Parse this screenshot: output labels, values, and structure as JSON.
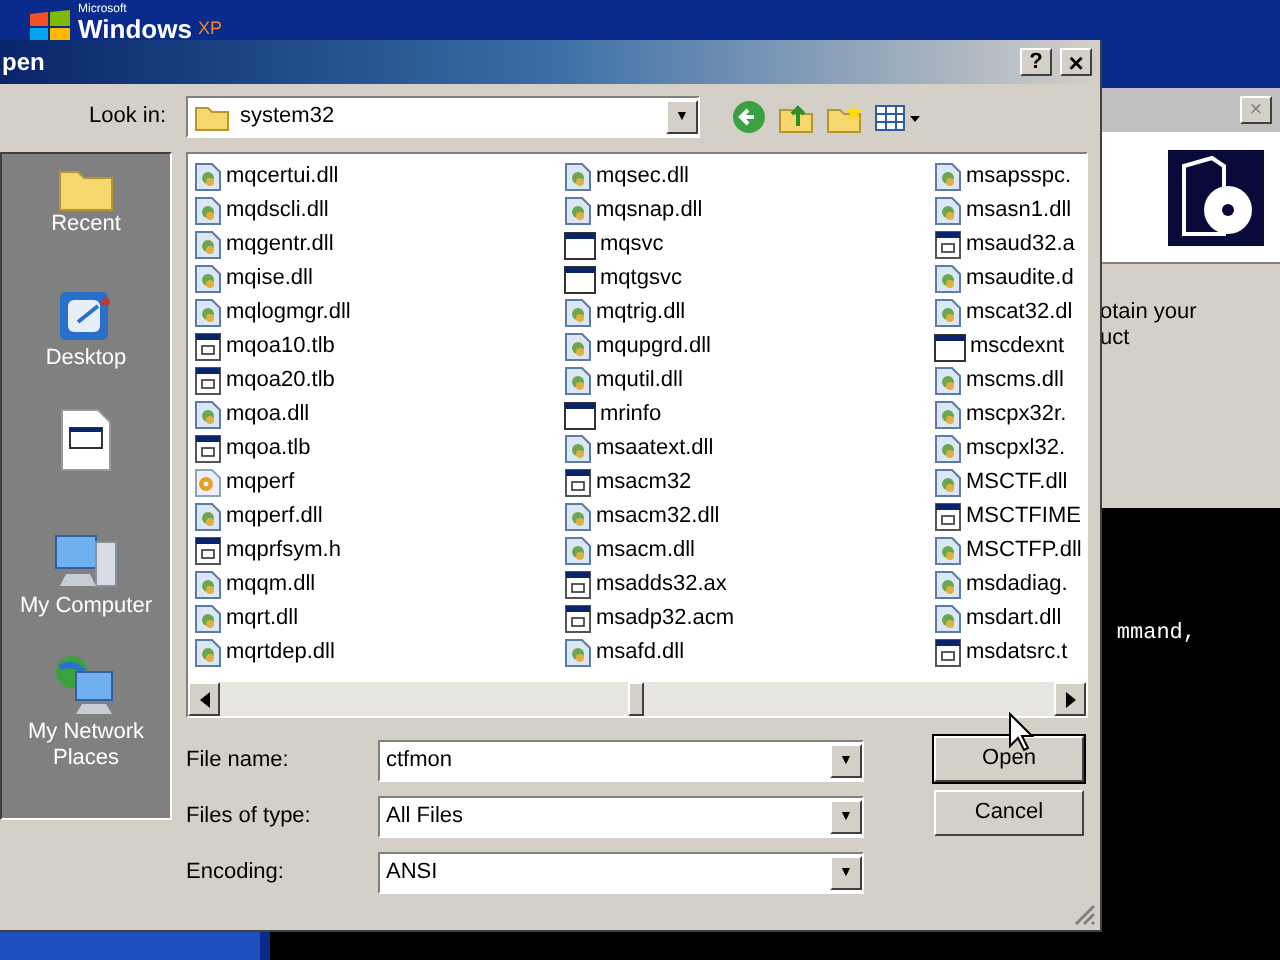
{
  "desktop_logo": {
    "brand": "Microsoft",
    "product": "Windows",
    "version": "XP"
  },
  "background_window": {
    "close": "×",
    "text_lines": [
      "otain your",
      "uct"
    ]
  },
  "console": {
    "text": "mmand,"
  },
  "dialog": {
    "title": "pen",
    "help": "?",
    "close": "×",
    "look_in": {
      "label": "Look in:",
      "value": "system32",
      "arrow": "▼"
    },
    "places": [
      {
        "kind": "recent",
        "label": "Recent"
      },
      {
        "kind": "desktop",
        "label": "Desktop"
      },
      {
        "kind": "document"
      },
      {
        "kind": "computer",
        "label": "My Computer"
      },
      {
        "kind": "network",
        "label": "My Network Places"
      }
    ],
    "files": [
      [
        {
          "name": "mqcertui.dll",
          "kind": "dll"
        },
        {
          "name": "mqdscli.dll",
          "kind": "dll"
        },
        {
          "name": "mqgentr.dll",
          "kind": "dll"
        },
        {
          "name": "mqise.dll",
          "kind": "dll"
        },
        {
          "name": "mqlogmgr.dll",
          "kind": "dll"
        },
        {
          "name": "mqoa10.tlb",
          "kind": "doc"
        },
        {
          "name": "mqoa20.tlb",
          "kind": "doc"
        },
        {
          "name": "mqoa.dll",
          "kind": "dll"
        },
        {
          "name": "mqoa.tlb",
          "kind": "doc"
        },
        {
          "name": "mqperf",
          "kind": "special"
        },
        {
          "name": "mqperf.dll",
          "kind": "dll"
        },
        {
          "name": "mqprfsym.h",
          "kind": "doc"
        },
        {
          "name": "mqqm.dll",
          "kind": "dll"
        },
        {
          "name": "mqrt.dll",
          "kind": "dll"
        },
        {
          "name": "mqrtdep.dll",
          "kind": "dll"
        }
      ],
      [
        {
          "name": "mqsec.dll",
          "kind": "dll"
        },
        {
          "name": "mqsnap.dll",
          "kind": "dll"
        },
        {
          "name": "mqsvc",
          "kind": "exe"
        },
        {
          "name": "mqtgsvc",
          "kind": "exe"
        },
        {
          "name": "mqtrig.dll",
          "kind": "dll"
        },
        {
          "name": "mqupgrd.dll",
          "kind": "dll"
        },
        {
          "name": "mqutil.dll",
          "kind": "dll"
        },
        {
          "name": "mrinfo",
          "kind": "exe"
        },
        {
          "name": "msaatext.dll",
          "kind": "dll"
        },
        {
          "name": "msacm32",
          "kind": "doc"
        },
        {
          "name": "msacm32.dll",
          "kind": "dll"
        },
        {
          "name": "msacm.dll",
          "kind": "dll"
        },
        {
          "name": "msadds32.ax",
          "kind": "doc"
        },
        {
          "name": "msadp32.acm",
          "kind": "doc"
        },
        {
          "name": "msafd.dll",
          "kind": "dll"
        }
      ],
      [
        {
          "name": "msapsspc.",
          "kind": "dll"
        },
        {
          "name": "msasn1.dll",
          "kind": "dll"
        },
        {
          "name": "msaud32.a",
          "kind": "doc"
        },
        {
          "name": "msaudite.d",
          "kind": "dll"
        },
        {
          "name": "mscat32.dl",
          "kind": "dll"
        },
        {
          "name": "mscdexnt",
          "kind": "exe"
        },
        {
          "name": "mscms.dll",
          "kind": "dll"
        },
        {
          "name": "mscpx32r.",
          "kind": "dll"
        },
        {
          "name": "mscpxl32.",
          "kind": "dll"
        },
        {
          "name": "MSCTF.dll",
          "kind": "dll"
        },
        {
          "name": "MSCTFIME",
          "kind": "doc"
        },
        {
          "name": "MSCTFP.dll",
          "kind": "dll"
        },
        {
          "name": "msdadiag.",
          "kind": "dll"
        },
        {
          "name": "msdart.dll",
          "kind": "dll"
        },
        {
          "name": "msdatsrc.t",
          "kind": "doc"
        }
      ]
    ],
    "fields": [
      {
        "label": "File name:",
        "value": "ctfmon",
        "arrow": "▼"
      },
      {
        "label": "Files of type:",
        "value": "All Files",
        "arrow": "▼"
      },
      {
        "label": "Encoding:",
        "value": "ANSI",
        "arrow": "▼"
      }
    ],
    "buttons": [
      "Open",
      "Cancel"
    ]
  }
}
